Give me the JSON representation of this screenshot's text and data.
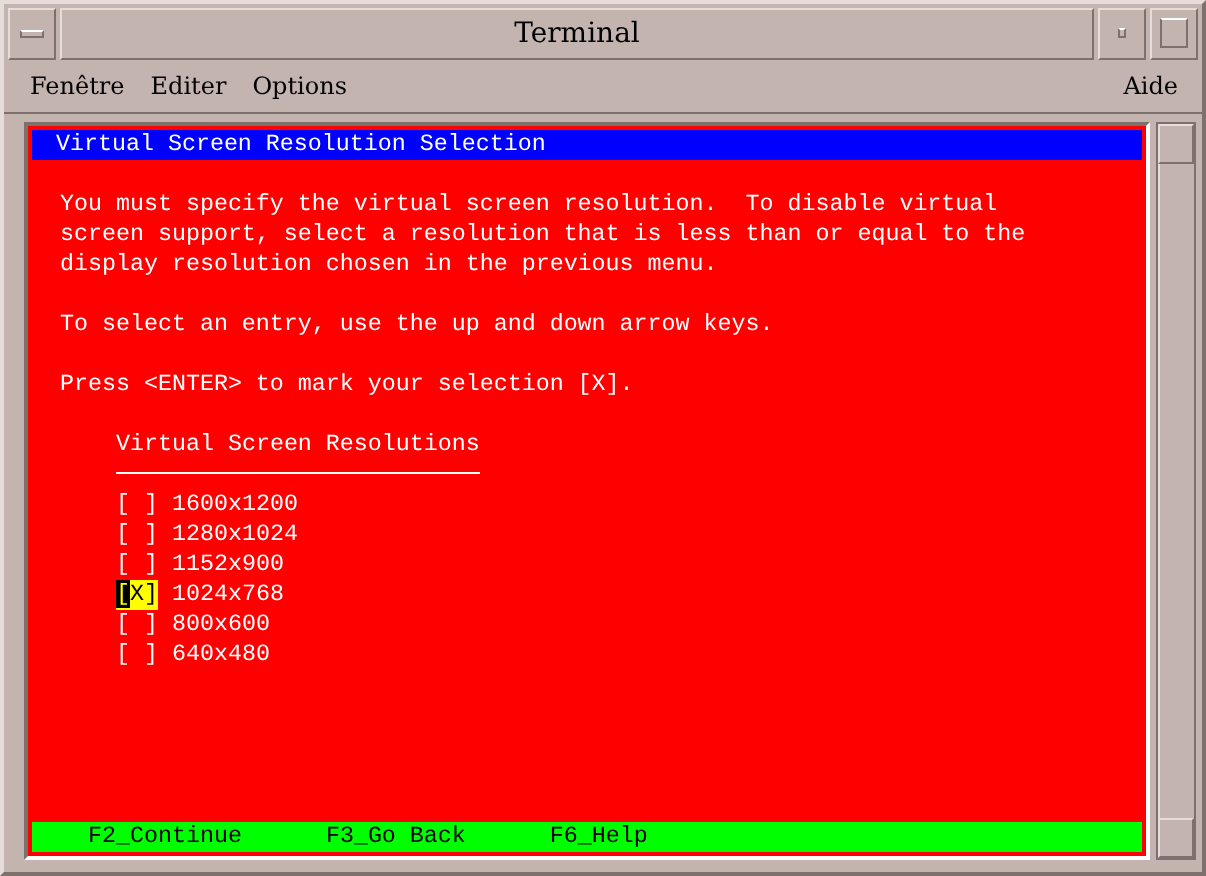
{
  "window": {
    "title": "Terminal"
  },
  "menu": {
    "left": [
      "Fenêtre",
      "Editer",
      "Options"
    ],
    "right": [
      "Aide"
    ]
  },
  "screen": {
    "title": "Virtual Screen Resolution Selection",
    "paragraphs": [
      "You must specify the virtual screen resolution.  To disable virtual\nscreen support, select a resolution that is less than or equal to the\ndisplay resolution chosen in the previous menu.",
      "To select an entry, use the up and down arrow keys.",
      "Press <ENTER> to mark your selection [X]."
    ],
    "list_heading": "Virtual Screen Resolutions",
    "options": [
      {
        "box": "[ ]",
        "label": "1600x1200",
        "selected": false
      },
      {
        "box": "[ ]",
        "label": "1280x1024",
        "selected": false
      },
      {
        "box": "[ ]",
        "label": "1152x900",
        "selected": false
      },
      {
        "box": "[X]",
        "label": "1024x768",
        "selected": true
      },
      {
        "box": "[ ]",
        "label": "800x600",
        "selected": false
      },
      {
        "box": "[ ]",
        "label": "640x480",
        "selected": false
      }
    ],
    "function_keys": [
      "F2_Continue",
      "F3_Go Back",
      "F6_Help"
    ]
  }
}
